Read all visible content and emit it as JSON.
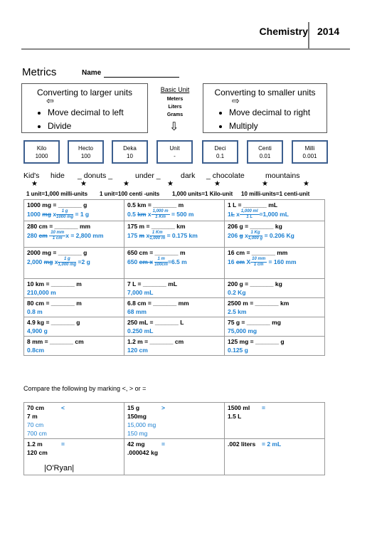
{
  "header": {
    "subject": "Chemistry",
    "year": "2014"
  },
  "title": "Metrics",
  "name_label": "Name",
  "larger_box": {
    "title": "Converting to larger units",
    "arrow_icon": "left-arrow-icon",
    "bullets": [
      "Move decimal to left",
      "Divide"
    ]
  },
  "basic_unit": {
    "title": "Basic Unit",
    "units": [
      "Meters",
      "Liters",
      "Grams"
    ]
  },
  "smaller_box": {
    "title": "Converting to smaller units",
    "arrow_icon": "right-arrow-icon",
    "bullets": [
      "Move decimal to right",
      "Multiply"
    ]
  },
  "prefixes": [
    {
      "name": "Kilo",
      "value": "1000"
    },
    {
      "name": "Hecto",
      "value": "100"
    },
    {
      "name": "Deka",
      "value": "10"
    },
    {
      "name": "Unit",
      "value": "-"
    },
    {
      "name": "Deci",
      "value": "0.1"
    },
    {
      "name": "Centi",
      "value": "0.01"
    },
    {
      "name": "Milli",
      "value": "0.001"
    }
  ],
  "mnemonic": [
    "Kid's",
    "hide",
    "_ donuts _",
    "under _",
    "dark",
    "_ chocolate",
    "mountains"
  ],
  "equivalences": [
    "1 unit=1,000 milli-units",
    "1 unit=100 centi -units",
    "1,000 units=1 Kilo-unit",
    "10 milli-units=1 centi-unit"
  ],
  "problems": [
    [
      {
        "q": "1000 mg = _______ g",
        "a_pre": "1000 ",
        "a_strike": "mg",
        "a_mid": " x",
        "num": "1 g",
        "den": "1000 mg",
        "a_post": " = 1 g"
      },
      {
        "q": "0.5  km = _______ m",
        "a_pre": "0.5 ",
        "a_strike": "km",
        "a_mid": " x",
        "num": "1,000 m",
        "den": "1 Km",
        "a_post": " = 500 m"
      },
      {
        "q": "1 L = _______ mL",
        "a_pre": "1",
        "a_strike": "L",
        "a_mid": " x",
        "num": "1,000 ml",
        "den": "1 L",
        "a_post": "=1,000 mL"
      }
    ],
    [
      {
        "q": "280 cm = _______ mm",
        "a_pre": "280 ",
        "a_strike": "cm",
        "a_mid": " ",
        "num": "10 mm",
        "den": "1 cm",
        "a_post": "x = 2,800 mm"
      },
      {
        "q": "175 m = _______ km",
        "a_pre": "175 ",
        "a_strike": "m",
        "a_mid": " x",
        "num": "1 Km",
        "den": "1,000 m",
        "a_post": " = 0.175 km"
      },
      {
        "q": "206 g = _______ kg",
        "a_pre": "206 ",
        "a_strike": "g",
        "a_mid": " x",
        "num": "1 Kg",
        "den": "1,000 g",
        "a_post": " = 0.206 Kg"
      }
    ],
    [
      {
        "q": "2000 mg = _______ g",
        "a_pre": "2,000 ",
        "a_strike": "mg",
        "a_mid": " x",
        "num": "1 g",
        "den": "1,000 mg",
        "a_post": " =2 g"
      },
      {
        "q": "650 cm = _______ m",
        "a_pre": "650 ",
        "a_strike": "cm x",
        "a_mid": " ",
        "num": "1 m",
        "den": "100cm",
        "a_post": "=6.5 m"
      },
      {
        "q": "16 cm = _______ mm",
        "a_pre": "16 ",
        "a_strike": "cm",
        "a_mid": " X",
        "num": "10 mm",
        "den": "1 cm",
        "a_post": " = 160 mm"
      }
    ],
    [
      {
        "q": "10  km = _______ m",
        "a": "210,000 m"
      },
      {
        "q": "7  L = _______ mL",
        "a": "7,000 mL"
      },
      {
        "q": "200 g = _______ kg",
        "a": "0.2 Kg"
      }
    ],
    [
      {
        "q": "80 cm = _______ m",
        "a": "0.8 m"
      },
      {
        "q": "6.8  cm = _______ mm",
        "a": "68 mm"
      },
      {
        "q": "2500 m = _______ km",
        "a": "2.5 km"
      }
    ],
    [
      {
        "q": "4.9  kg = _______ g",
        "a": "4,900 g"
      },
      {
        "q": "250  mL = _______ L",
        "a": "0.250 mL"
      },
      {
        "q": "75 g = _______ mg",
        "a": "75,000 mg"
      }
    ],
    [
      {
        "q": "8 mm = _______ cm",
        "a": "0.8cm"
      },
      {
        "q": "1.2 m = _______ cm",
        "a": "120 cm"
      },
      {
        "q": "125 mg = _______ g",
        "a": "0.125 g"
      }
    ]
  ],
  "compare_instructions": "Compare the following by marking <, > or =",
  "comparisons": [
    [
      {
        "left": "70  cm",
        "op": "<",
        "right": "7 m",
        "left_ans": "70 cm",
        "right_ans": "700 cm"
      },
      {
        "left": "15 g",
        "op": ">",
        "right": "150mg",
        "left_ans": "15,000 mg",
        "right_ans": "150 mg"
      },
      {
        "left": "1500 ml",
        "op": "=",
        "right": "1.5 L",
        "left_ans": "",
        "right_ans": ""
      }
    ],
    [
      {
        "left": "1.2 m",
        "op": "=",
        "right": "120 cm",
        "left_ans": "",
        "right_ans": ""
      },
      {
        "left": "42 mg",
        "op": "=",
        "right": ".000042 kg",
        "left_ans": "",
        "right_ans": ""
      },
      {
        "left": ".002 liters",
        "op": "= 2 mL",
        "right": "",
        "left_ans": "",
        "right_ans": ""
      }
    ]
  ],
  "signature": "|O'Ryan|"
}
